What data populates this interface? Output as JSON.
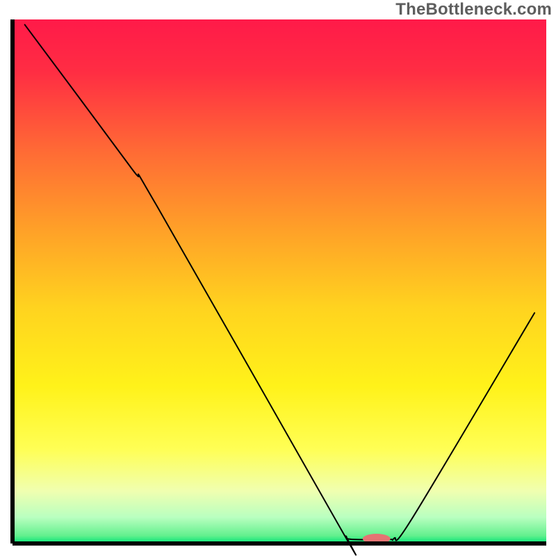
{
  "watermark": "TheBottleneck.com",
  "chart_data": {
    "type": "line",
    "title": "",
    "xlabel": "",
    "ylabel": "",
    "xlim": [
      0,
      100
    ],
    "ylim": [
      0,
      100
    ],
    "background_gradient": {
      "stops": [
        {
          "offset": 0.0,
          "color": "#ff1a49"
        },
        {
          "offset": 0.1,
          "color": "#ff2d43"
        },
        {
          "offset": 0.25,
          "color": "#ff6a35"
        },
        {
          "offset": 0.4,
          "color": "#ffa028"
        },
        {
          "offset": 0.55,
          "color": "#ffd31f"
        },
        {
          "offset": 0.7,
          "color": "#fff21a"
        },
        {
          "offset": 0.82,
          "color": "#ffff55"
        },
        {
          "offset": 0.9,
          "color": "#f0ffb0"
        },
        {
          "offset": 0.95,
          "color": "#b9ffc0"
        },
        {
          "offset": 0.985,
          "color": "#63f08e"
        },
        {
          "offset": 1.0,
          "color": "#00e676"
        }
      ]
    },
    "series": [
      {
        "name": "bottleneck-curve",
        "type": "path",
        "points": [
          {
            "x": 2.3,
            "y": 99.0
          },
          {
            "x": 22.0,
            "y": 72.0
          },
          {
            "x": 27.0,
            "y": 64.5
          },
          {
            "x": 61.5,
            "y": 2.8
          },
          {
            "x": 62.5,
            "y": 1.4
          },
          {
            "x": 63.5,
            "y": 0.8
          },
          {
            "x": 70.5,
            "y": 0.8
          },
          {
            "x": 71.5,
            "y": 1.0
          },
          {
            "x": 75.0,
            "y": 5.0
          },
          {
            "x": 97.8,
            "y": 44.0
          }
        ]
      }
    ],
    "marker": {
      "name": "optimal-marker",
      "cx": 68.2,
      "cy": 0.9,
      "rx": 2.6,
      "ry": 0.95,
      "fill": "#e57373"
    },
    "axes": {
      "stroke": "#000000",
      "stroke_width": 6
    }
  }
}
